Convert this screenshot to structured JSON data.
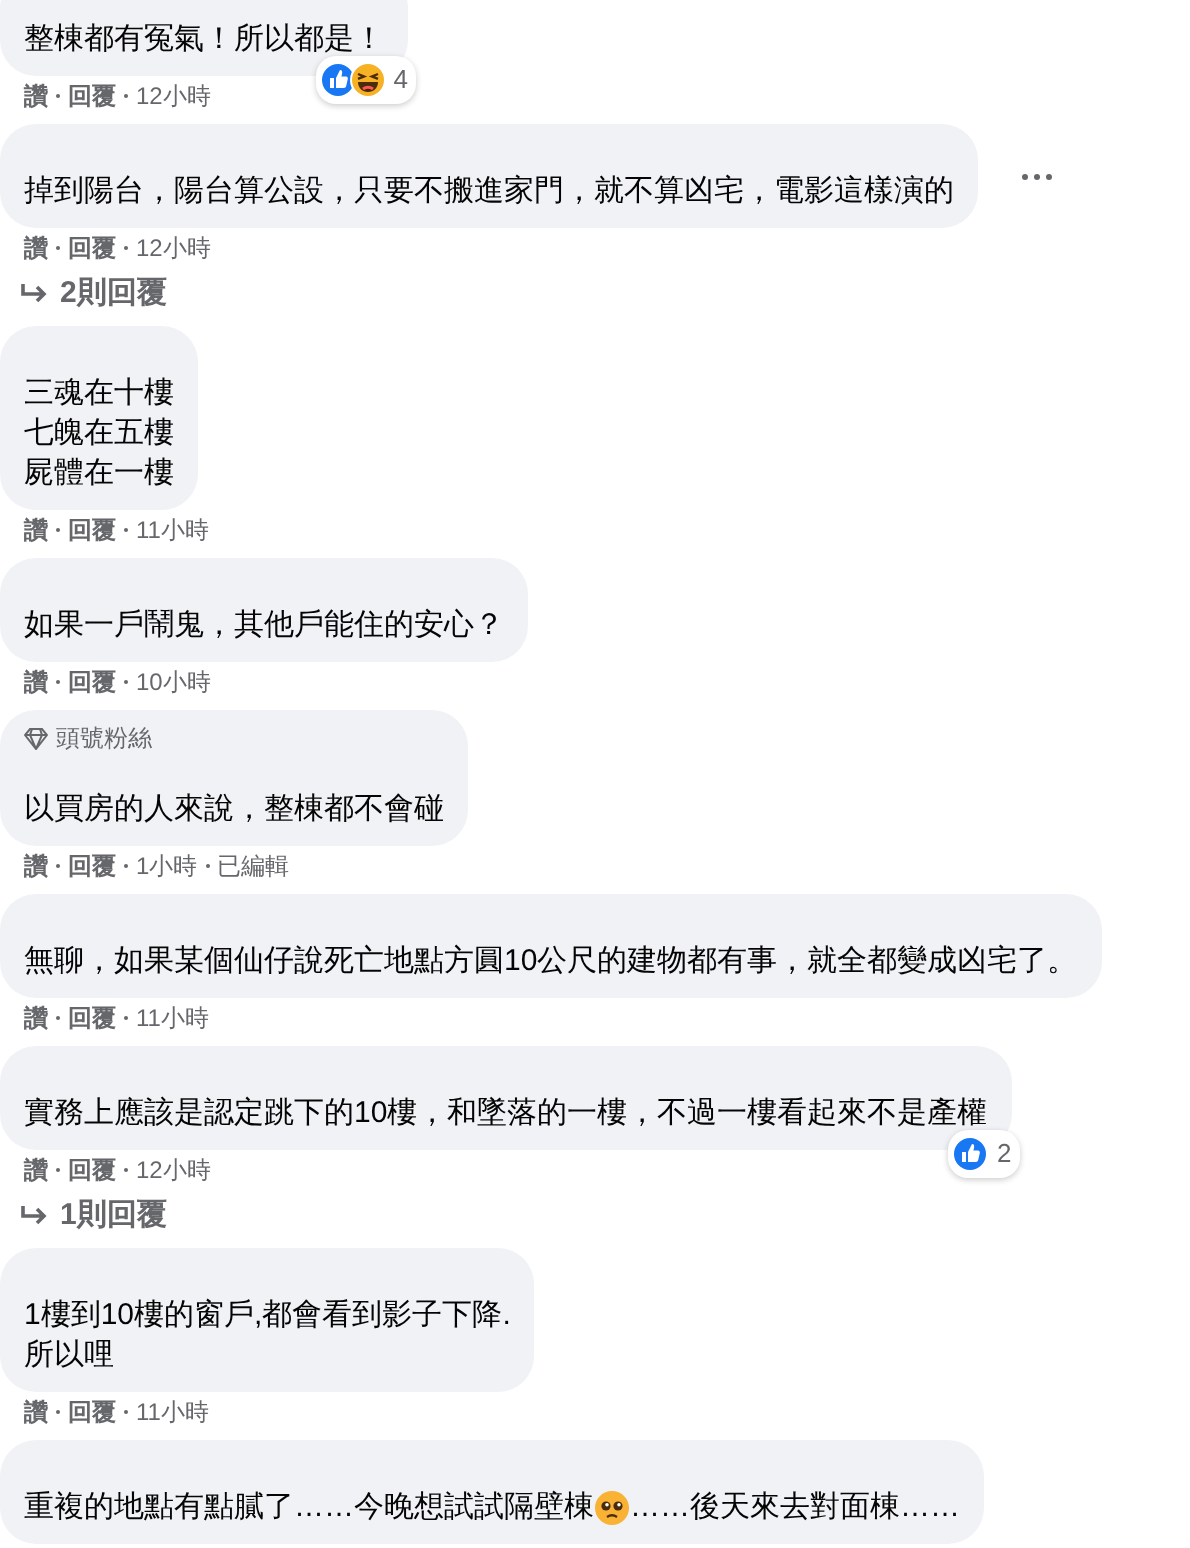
{
  "comments": [
    {
      "lines": [
        "整棟都有冤氣！所以都是！"
      ],
      "reactions": {
        "like": true,
        "haha": true,
        "count": "4"
      },
      "like": "讚",
      "reply": "回覆",
      "time": "12小時",
      "more_button": false
    },
    {
      "lines": [
        "掉到陽台，陽台算公設，只要不搬進家門，就不算凶宅，電影這樣演的"
      ],
      "like": "讚",
      "reply": "回覆",
      "time": "12小時",
      "more_button": true,
      "replies": "2則回覆"
    },
    {
      "lines": [
        "三魂在十樓",
        "七魄在五樓",
        "屍體在一樓"
      ],
      "like": "讚",
      "reply": "回覆",
      "time": "11小時",
      "more_button": false
    },
    {
      "lines": [
        "如果一戶鬧鬼，其他戶能住的安心？"
      ],
      "like": "讚",
      "reply": "回覆",
      "time": "10小時",
      "more_button": false
    },
    {
      "badge": "頭號粉絲",
      "lines": [
        "以買房的人來說，整棟都不會碰"
      ],
      "like": "讚",
      "reply": "回覆",
      "time": "1小時",
      "edited": "已編輯",
      "more_button": false
    },
    {
      "lines": [
        "無聊，如果某個仙仔說死亡地點方圓10公尺的建物都有事，就全都變成凶宅了。"
      ],
      "like": "讚",
      "reply": "回覆",
      "time": "11小時",
      "more_button": false
    },
    {
      "lines": [
        "實務上應該是認定跳下的10樓，和墜落的一樓，不過一樓看起來不是產權"
      ],
      "reactions": {
        "like": true,
        "haha": false,
        "count": "2"
      },
      "like": "讚",
      "reply": "回覆",
      "time": "12小時",
      "more_button": false,
      "replies": "1則回覆"
    },
    {
      "lines": [
        "1樓到10樓的窗戶,都會看到影子下降.",
        "所以哩"
      ],
      "like": "讚",
      "reply": "回覆",
      "time": "11小時",
      "more_button": false
    },
    {
      "parts": [
        {
          "kind": "text",
          "text": "重複的地點有點膩了……今晚想試試隔壁棟"
        },
        {
          "kind": "emoji"
        },
        {
          "kind": "text",
          "text": "……後天來去對面棟……"
        }
      ],
      "more_button": false
    }
  ]
}
